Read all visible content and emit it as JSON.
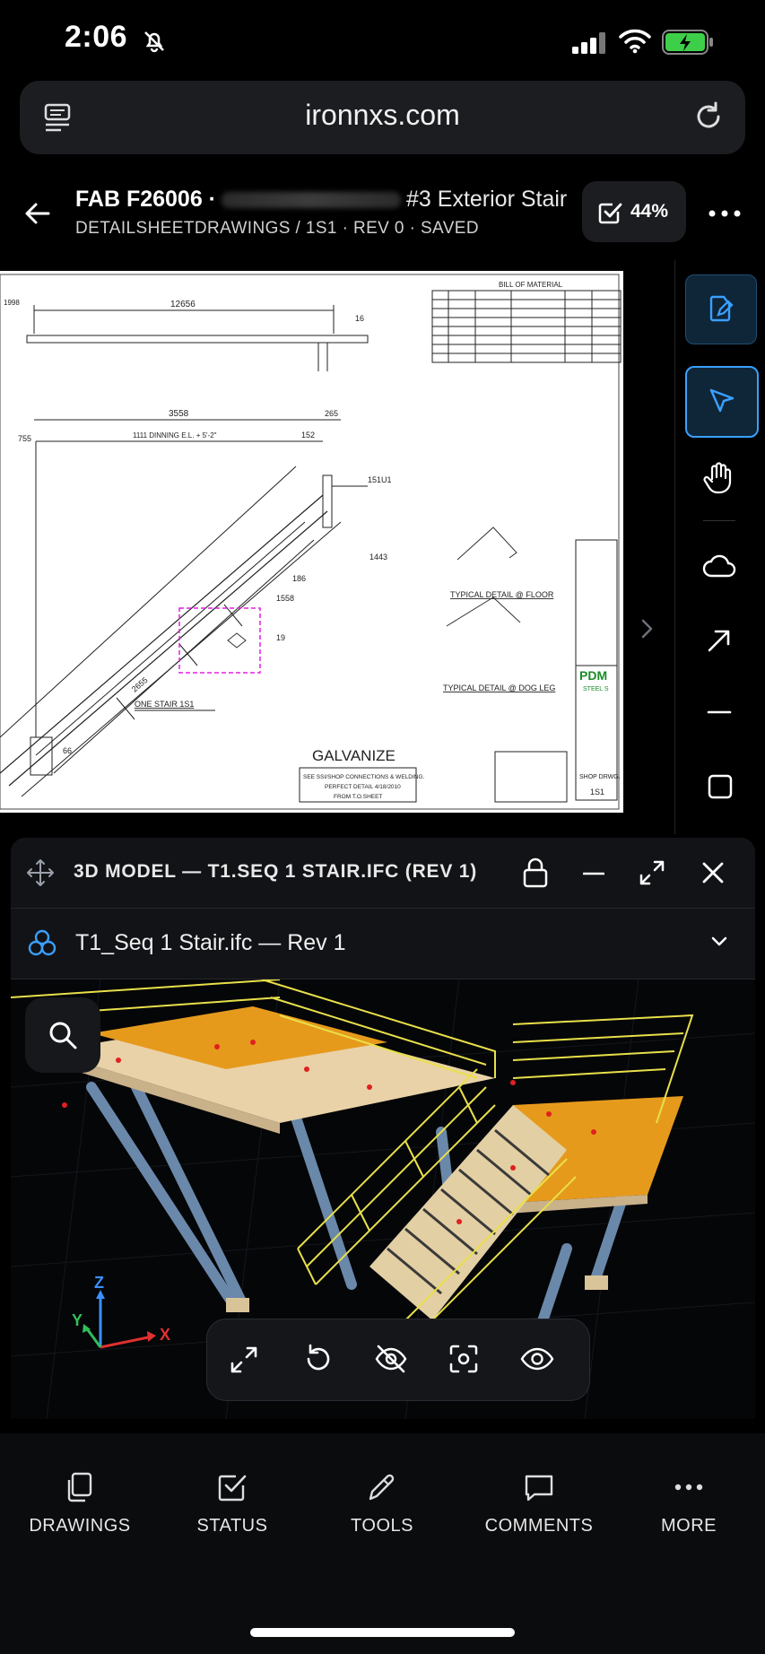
{
  "status_bar": {
    "time": "2:06"
  },
  "browser": {
    "url": "ironnxs.com"
  },
  "header": {
    "title_prefix": "FAB  F26006 ·",
    "title_suffix": "#3 Exterior Stair",
    "breadcrumb": "DETAILSHEETDRAWINGS / 1S1 · REV 0 · SAVED",
    "progress": "44%"
  },
  "drawing": {
    "labels": {
      "bom_title": "BILL OF MATERIAL",
      "dim_top": "12656",
      "dim_mid": "3558",
      "dim_265": "265",
      "dim_152": "152",
      "dim_755": "755",
      "dim_1998": "1998",
      "dim_dinning": "1111 DINNING E.L. + 5'-2\"",
      "dim_16": "16",
      "dim_151u1": "151U1",
      "dim_1443": "1443",
      "dim_1558": "1558",
      "dim_19": "19",
      "dim_66": "66",
      "dim_2655": "2655",
      "dim_186": "186",
      "stair_label": "ONE STAIR 1S1",
      "detail_floor": "TYPICAL DETAIL @ FLOOR",
      "detail_dogleg": "TYPICAL DETAIL @ DOG LEG",
      "galvanize": "GALVANIZE",
      "note_1": "SEE SSI/SHOP CONNECTIONS & WELDING.",
      "note_2": "PERFECT DETAIL 4/18/2010",
      "note_3": "FROM T.O.SHEET",
      "logo_pdm": "PDM",
      "logo_steel": "STEEL S",
      "shop_drwg": "SHOP DRWG.",
      "sheet_no": "1S1"
    }
  },
  "model_panel": {
    "title": "3D MODEL — T1.SEQ 1 STAIR.IFC (REV 1)",
    "file": "T1_Seq 1 Stair.ifc — Rev 1",
    "axes": {
      "x": "X",
      "y": "Y",
      "z": "Z"
    }
  },
  "bottom_nav": {
    "items": [
      {
        "label": "DRAWINGS"
      },
      {
        "label": "STATUS"
      },
      {
        "label": "TOOLS"
      },
      {
        "label": "COMMENTS"
      },
      {
        "label": "MORE"
      }
    ]
  }
}
